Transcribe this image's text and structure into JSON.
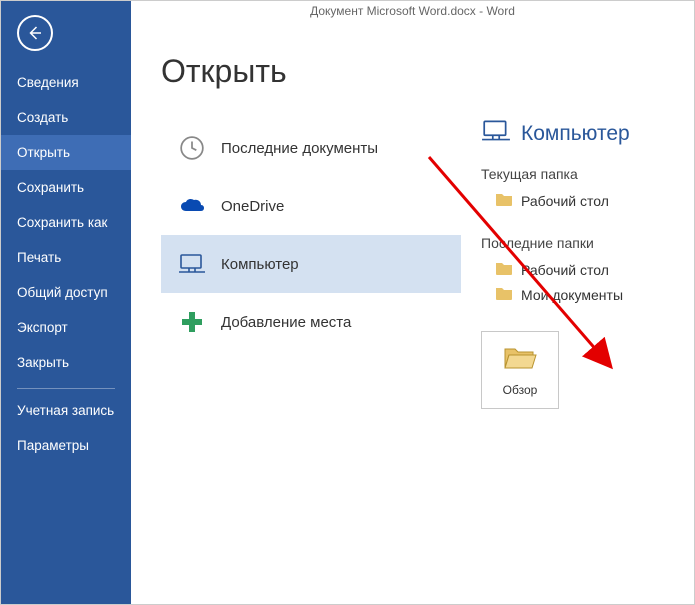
{
  "window": {
    "title": "Документ Microsoft Word.docx - Word"
  },
  "page": {
    "title": "Открыть"
  },
  "sidebar": {
    "items": [
      {
        "label": "Сведения"
      },
      {
        "label": "Создать"
      },
      {
        "label": "Открыть"
      },
      {
        "label": "Сохранить"
      },
      {
        "label": "Сохранить как"
      },
      {
        "label": "Печать"
      },
      {
        "label": "Общий доступ"
      },
      {
        "label": "Экспорт"
      },
      {
        "label": "Закрыть"
      }
    ],
    "footer": [
      {
        "label": "Учетная запись"
      },
      {
        "label": "Параметры"
      }
    ]
  },
  "locations": [
    {
      "label": "Последние документы"
    },
    {
      "label": "OneDrive"
    },
    {
      "label": "Компьютер"
    },
    {
      "label": "Добавление места"
    }
  ],
  "details": {
    "title": "Компьютер",
    "current_folder_label": "Текущая папка",
    "current_folder": {
      "name": "Рабочий стол"
    },
    "recent_folders_label": "Последние папки",
    "recent_folders": [
      {
        "name": "Рабочий стол"
      },
      {
        "name": "Мои документы"
      }
    ],
    "browse_label": "Обзор"
  },
  "colors": {
    "accent": "#2a579a"
  }
}
